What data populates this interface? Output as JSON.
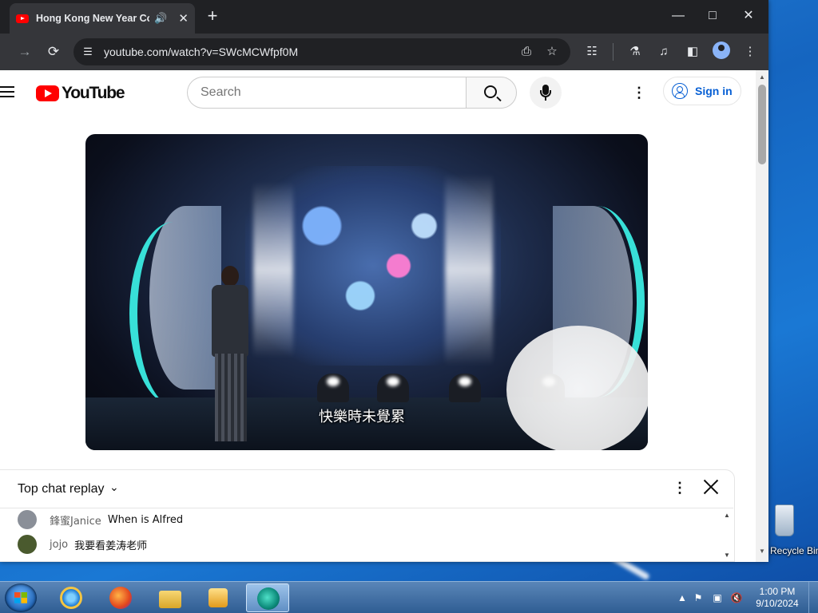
{
  "browser": {
    "tab_title": "Hong Kong New Year Countdown",
    "url": "youtube.com/watch?v=SWcMCWfpf0M"
  },
  "youtube": {
    "logo_text": "YouTube",
    "search_placeholder": "Search",
    "sign_in_label": "Sign in"
  },
  "video": {
    "subtitle": "快樂時未覺累"
  },
  "chat": {
    "header_label": "Top chat replay",
    "messages": [
      {
        "author": "鋒蜜Janice",
        "text": "When is Alfred",
        "avatar_color": "#8a8f98"
      },
      {
        "author": "jojo",
        "text": "我要看姜涛老师",
        "avatar_color": "#4a5a2e"
      }
    ]
  },
  "desktop": {
    "recycle_bin_label": "Recycle Bin"
  },
  "taskbar": {
    "time": "1:00 PM",
    "date": "9/10/2024"
  },
  "colors": {
    "youtube_red": "#ff0000",
    "link_blue": "#065fd4",
    "chrome_dark": "#202124"
  }
}
